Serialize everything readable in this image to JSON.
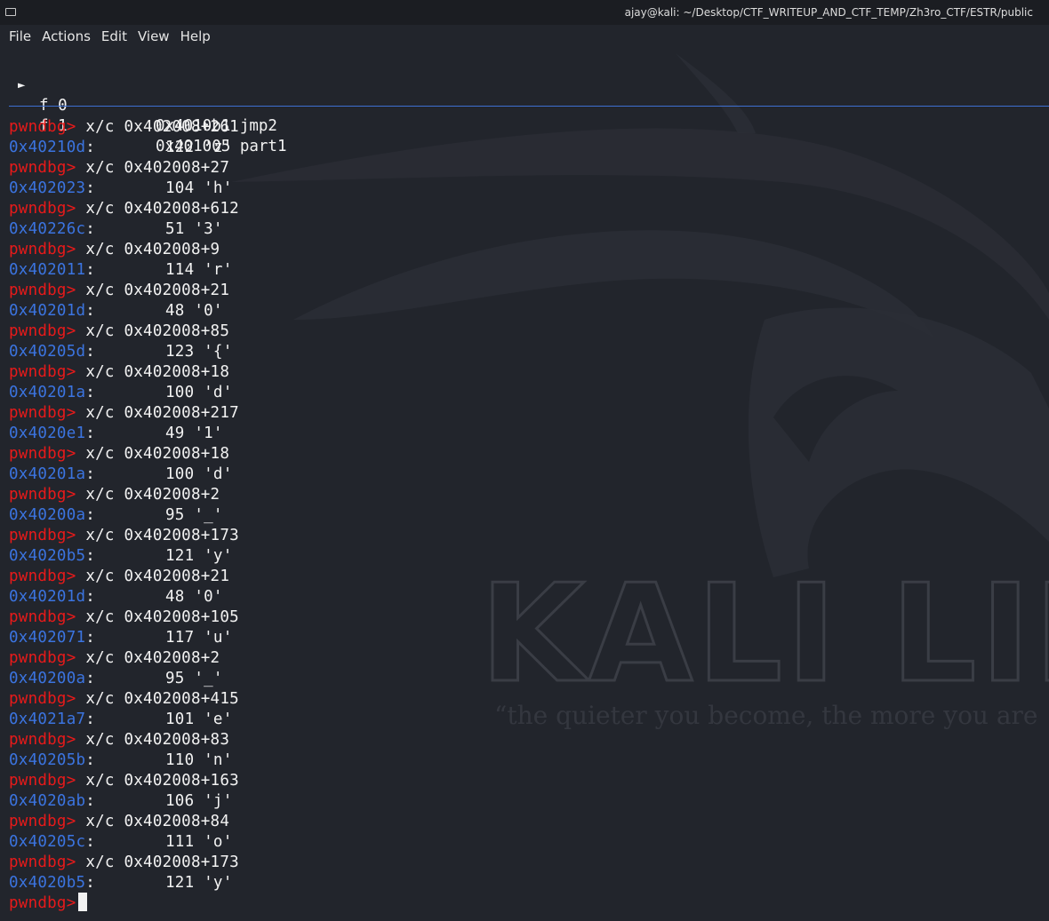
{
  "window": {
    "title": "ajay@kali: ~/Desktop/CTF_WRITEUP_AND_CTF_TEMP/Zh3ro_CTF/ESTR/public"
  },
  "menu": [
    "File",
    "Actions",
    "Edit",
    "View",
    "Help"
  ],
  "backtrace": [
    {
      "marker": "►",
      "frame": "f 0",
      "addr_name": "0x4010b1 jmp2"
    },
    {
      "marker": "",
      "frame": "f 1",
      "addr_name": "0x401005 part1"
    }
  ],
  "wallpaper": {
    "logo_text": "KALI LIN",
    "tagline": "“the quieter you become, the more you are"
  },
  "prompt": "pwndbg>",
  "entries": [
    {
      "cmd": "x/c 0x402008+261",
      "addr": "0x40210d",
      "val": "122 'z'"
    },
    {
      "cmd": "x/c 0x402008+27",
      "addr": "0x402023",
      "val": "104 'h'"
    },
    {
      "cmd": "x/c 0x402008+612",
      "addr": "0x40226c",
      "val": "51 '3'"
    },
    {
      "cmd": "x/c 0x402008+9",
      "addr": "0x402011",
      "val": "114 'r'"
    },
    {
      "cmd": "x/c 0x402008+21",
      "addr": "0x40201d",
      "val": "48 '0'"
    },
    {
      "cmd": "x/c 0x402008+85",
      "addr": "0x40205d",
      "val": "123 '{'"
    },
    {
      "cmd": "x/c 0x402008+18",
      "addr": "0x40201a",
      "val": "100 'd'"
    },
    {
      "cmd": "x/c 0x402008+217",
      "addr": "0x4020e1",
      "val": "49 '1'"
    },
    {
      "cmd": "x/c 0x402008+18",
      "addr": "0x40201a",
      "val": "100 'd'"
    },
    {
      "cmd": "x/c 0x402008+2",
      "addr": "0x40200a",
      "val": "95 '_'"
    },
    {
      "cmd": "x/c 0x402008+173",
      "addr": "0x4020b5",
      "val": "121 'y'"
    },
    {
      "cmd": "x/c 0x402008+21",
      "addr": "0x40201d",
      "val": "48 '0'"
    },
    {
      "cmd": "x/c 0x402008+105",
      "addr": "0x402071",
      "val": "117 'u'"
    },
    {
      "cmd": "x/c 0x402008+2",
      "addr": "0x40200a",
      "val": "95 '_'"
    },
    {
      "cmd": "x/c 0x402008+415",
      "addr": "0x4021a7",
      "val": "101 'e'"
    },
    {
      "cmd": "x/c 0x402008+83",
      "addr": "0x40205b",
      "val": "110 'n'"
    },
    {
      "cmd": "x/c 0x402008+163",
      "addr": "0x4020ab",
      "val": "106 'j'"
    },
    {
      "cmd": "x/c 0x402008+84",
      "addr": "0x40205c",
      "val": "111 'o'"
    },
    {
      "cmd": "x/c 0x402008+173",
      "addr": "0x4020b5",
      "val": "121 'y'"
    }
  ],
  "colors": {
    "prompt": "#e81a1a",
    "address": "#3b74e0",
    "text": "#f2f2f2",
    "background": "#22252c",
    "separator": "#3e6fd1"
  }
}
